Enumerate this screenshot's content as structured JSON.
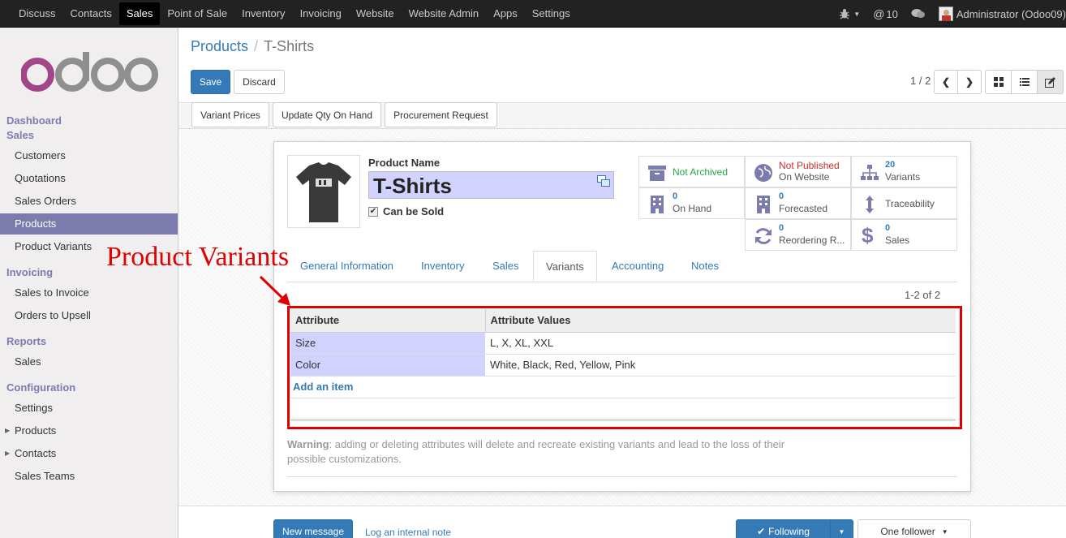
{
  "topbar": {
    "menu": [
      "Discuss",
      "Contacts",
      "Sales",
      "Point of Sale",
      "Inventory",
      "Invoicing",
      "Website",
      "Website Admin",
      "Apps",
      "Settings"
    ],
    "active": "Sales",
    "mentions": "10",
    "user": "Administrator (Odoo09)"
  },
  "sidebar": {
    "sections": [
      {
        "title": "Dashboard",
        "items": []
      },
      {
        "title": "Sales",
        "items": [
          "Customers",
          "Quotations",
          "Sales Orders",
          "Products",
          "Product Variants"
        ]
      },
      {
        "title": "Invoicing",
        "items": [
          "Sales to Invoice",
          "Orders to Upsell"
        ]
      },
      {
        "title": "Reports",
        "items": [
          "Sales"
        ]
      },
      {
        "title": "Configuration",
        "items": [
          "Settings",
          "Products",
          "Contacts",
          "Sales Teams"
        ]
      }
    ],
    "active_item": "Products"
  },
  "breadcrumb": {
    "parent": "Products",
    "current": "T-Shirts"
  },
  "buttons": {
    "save": "Save",
    "discard": "Discard"
  },
  "pager": {
    "value": "1 / 2"
  },
  "statusbar": {
    "buttons": [
      "Variant Prices",
      "Update Qty On Hand",
      "Procurement Request"
    ]
  },
  "product": {
    "name_label": "Product Name",
    "name": "T-Shirts",
    "can_be_sold": "Can be Sold"
  },
  "stats": {
    "archived": "Not Archived",
    "published_1": "Not Published",
    "published_2": "On Website",
    "variants_count": "20",
    "variants_label": "Variants",
    "onhand_count": "0",
    "onhand_label": "On Hand",
    "forecast_count": "0",
    "forecast_label": "Forecasted",
    "traceability": "Traceability",
    "reorder_count": "0",
    "reorder_label": "Reordering R...",
    "sales_count": "0",
    "sales_label": "Sales"
  },
  "tabs": [
    "General Information",
    "Inventory",
    "Sales",
    "Variants",
    "Accounting",
    "Notes"
  ],
  "active_tab": "Variants",
  "annotation": "Product Variants",
  "variants_table": {
    "pager": "1-2 of 2",
    "headers": [
      "Attribute",
      "Attribute Values"
    ],
    "rows": [
      {
        "attribute": "Size",
        "values": "L, X, XL, XXL"
      },
      {
        "attribute": "Color",
        "values": "White, Black, Red, Yellow, Pink"
      }
    ],
    "add_item": "Add an item"
  },
  "warning": {
    "bold": "Warning",
    "text": ": adding or deleting attributes will delete and recreate existing variants and lead to the loss of their possible customizations."
  },
  "chatter": {
    "new_message": "New message",
    "log_note": "Log an internal note",
    "following": "Following",
    "followers": "One follower"
  },
  "colors": {
    "accent": "#7c7bad",
    "primary": "#337ab7",
    "annotation": "#e00000"
  }
}
